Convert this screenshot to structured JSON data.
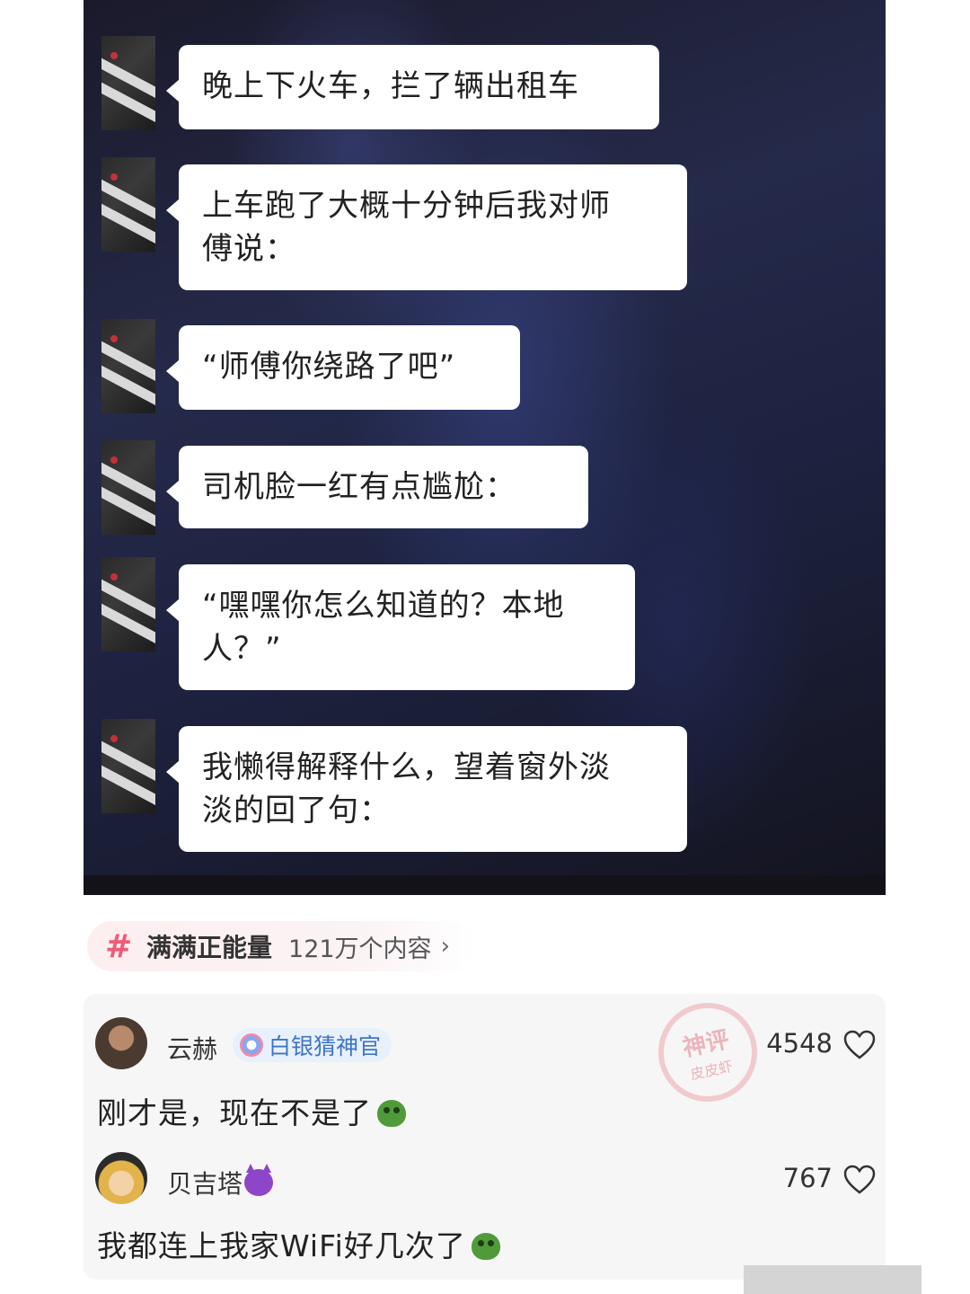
{
  "chat": {
    "messages": [
      {
        "lines": [
          "晚上下火车，拦了辆出租车"
        ]
      },
      {
        "lines": [
          "上车跑了大概十分钟后我对师",
          "傅说："
        ]
      },
      {
        "lines": [
          "“师傅你绕路了吧”"
        ]
      },
      {
        "lines": [
          "司机脸一红有点尴尬："
        ]
      },
      {
        "lines": [
          "“嘿嘿你怎么知道的？本地",
          "人？”"
        ]
      },
      {
        "lines": [
          "我懒得解释什么，望着窗外淡",
          "淡的回了句："
        ]
      }
    ]
  },
  "topic": {
    "hash_icon": "hash-icon",
    "name": "满满正能量",
    "count": "121万个内容",
    "chevron": "›",
    "accent_color": "#f05b75"
  },
  "comments": [
    {
      "user": "云赫",
      "badge": "白银猜神官",
      "likes": "4548",
      "text": "刚才是，现在不是了",
      "emoji": "green-face-emoji"
    },
    {
      "user": "贝吉塔",
      "emoji_after_name": "devil-emoji",
      "likes": "767",
      "text": "我都连上我家WiFi好几次了",
      "emoji": "green-face-emoji"
    }
  ],
  "watermark": {
    "line1": "神评",
    "line2": "皮皮虾"
  }
}
